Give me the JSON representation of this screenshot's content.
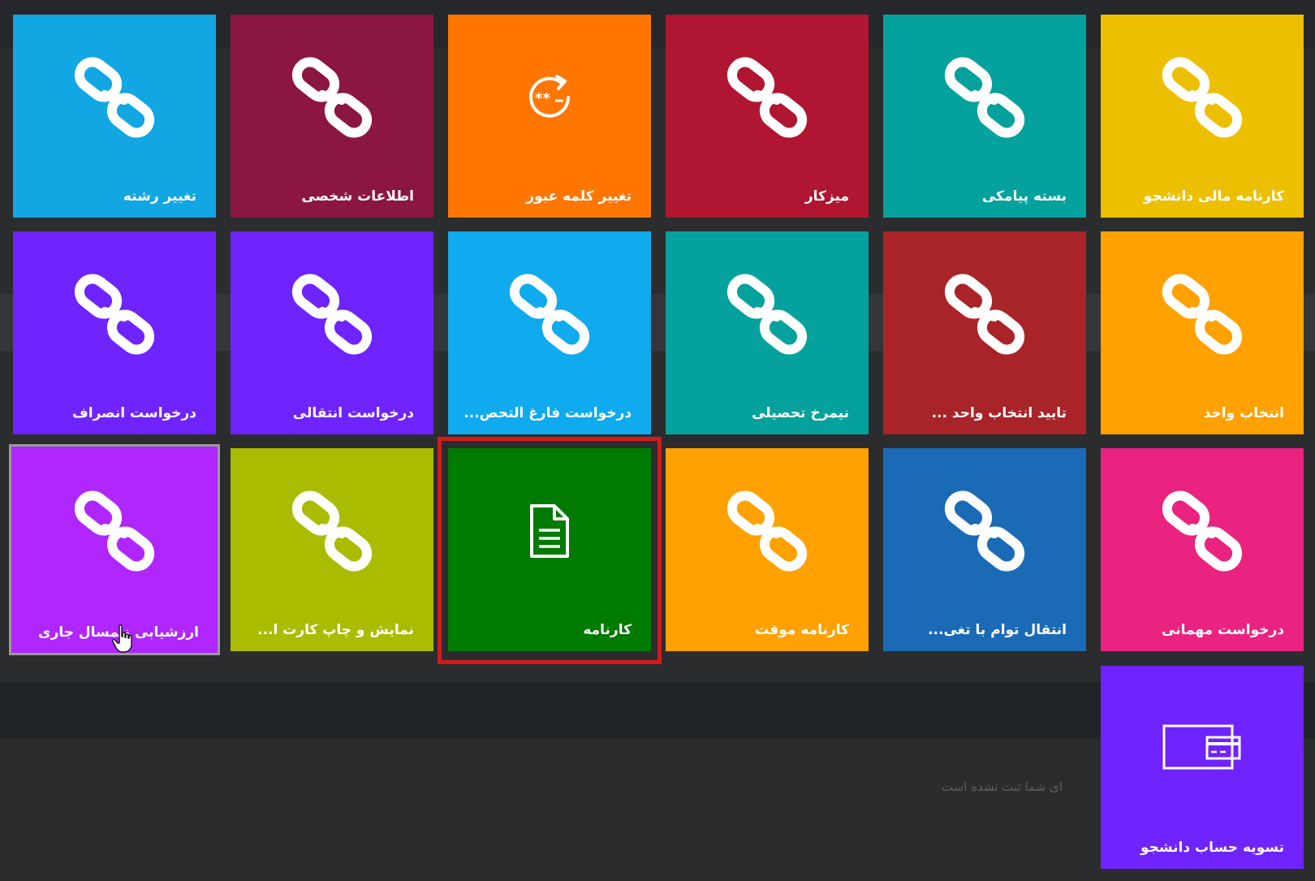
{
  "background_note": "ای شما ثبت نشده است",
  "tiles": [
    {
      "label": "کارنامه مالی دانشجو",
      "color": "#ecc000",
      "icon": "link-icon"
    },
    {
      "label": "بسته پیامکی",
      "color": "#05a19d",
      "icon": "link-icon"
    },
    {
      "label": "میزکار",
      "color": "#b01531",
      "icon": "link-icon"
    },
    {
      "label": "تغییر کلمه عبور",
      "color": "#ff7600",
      "icon": "password-reset-icon"
    },
    {
      "label": "اطلاعات شخصی",
      "color": "#8b1642",
      "icon": "link-icon"
    },
    {
      "label": "تغییر رشته",
      "color": "#12a6e2",
      "icon": "link-icon"
    },
    {
      "label": "انتخاب واحد",
      "color": "#ffa100",
      "icon": "link-icon"
    },
    {
      "label": "تایید انتخاب واحد ...",
      "color": "#a82428",
      "icon": "link-icon"
    },
    {
      "label": "نیمرخ تحصیلی",
      "color": "#05a19d",
      "icon": "link-icon"
    },
    {
      "label": "درخواست فارغ التحص...",
      "color": "#10aaee",
      "icon": "link-icon"
    },
    {
      "label": "درخواست انتقالی",
      "color": "#6e23ff",
      "icon": "link-icon"
    },
    {
      "label": "درخواست انصراف",
      "color": "#6e23ff",
      "icon": "link-icon"
    },
    {
      "label": "درخواست مهمانی",
      "color": "#ea2280",
      "icon": "link-icon"
    },
    {
      "label": "انتقال توام با تغی...",
      "color": "#1b6ab6",
      "icon": "link-icon"
    },
    {
      "label": "کارنامه موقت",
      "color": "#ffa100",
      "icon": "link-icon"
    },
    {
      "label": "کارنامه",
      "color": "#007a00",
      "icon": "document-icon"
    },
    {
      "label": "نمایش و چاپ کارت ا...",
      "color": "#a9bc00",
      "icon": "link-icon"
    },
    {
      "label": "ارزشیابی نیمسال جاری",
      "color": "#b026ff",
      "icon": "link-icon"
    },
    {
      "label": "تسویه حساب دانشجو",
      "color": "#6e23ff",
      "icon": "payment-card-icon"
    }
  ]
}
